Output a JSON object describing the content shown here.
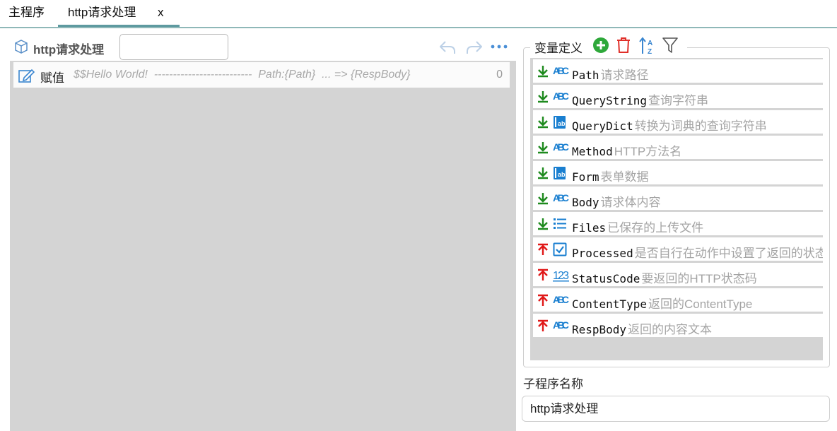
{
  "tabs": [
    {
      "label": "主程序"
    },
    {
      "label": "http请求处理",
      "close": "x"
    }
  ],
  "editor": {
    "title": "http请求处理",
    "search_value": "",
    "statement": {
      "keyword": "赋值",
      "expression": "$$Hello World!  --------------------------  Path:{Path}  ... => {RespBody}",
      "count": "0"
    }
  },
  "variables": {
    "title": "变量定义",
    "items": [
      {
        "name": "Path",
        "desc": "请求路径",
        "dir": "in",
        "type": "ABC"
      },
      {
        "name": "QueryString",
        "desc": "查询字符串",
        "dir": "in",
        "type": "ABC"
      },
      {
        "name": "QueryDict",
        "desc": "转换为词典的查询字符串",
        "dir": "in",
        "type": "dict"
      },
      {
        "name": "Method",
        "desc": "HTTP方法名",
        "dir": "in",
        "type": "ABC"
      },
      {
        "name": "Form",
        "desc": "表单数据",
        "dir": "in",
        "type": "dict"
      },
      {
        "name": "Body",
        "desc": "请求体内容",
        "dir": "in",
        "type": "ABC"
      },
      {
        "name": "Files",
        "desc": "已保存的上传文件",
        "dir": "in",
        "type": "list"
      },
      {
        "name": "Processed",
        "desc": "是否自行在动作中设置了返回的状态",
        "dir": "out",
        "type": "bool"
      },
      {
        "name": "StatusCode",
        "desc": "要返回的HTTP状态码",
        "dir": "out",
        "type": "123"
      },
      {
        "name": "ContentType",
        "desc": "返回的ContentType",
        "dir": "out",
        "type": "ABC"
      },
      {
        "name": "RespBody",
        "desc": "返回的内容文本",
        "dir": "out",
        "type": "ABC"
      }
    ]
  },
  "subprogram": {
    "label": "子程序名称",
    "value": "http请求处理"
  },
  "colors": {
    "in_arrow": "#1e8a1e",
    "out_arrow": "#e01818",
    "type_blue": "#1a7fd0",
    "accent_tab": "#5e9aa0"
  }
}
